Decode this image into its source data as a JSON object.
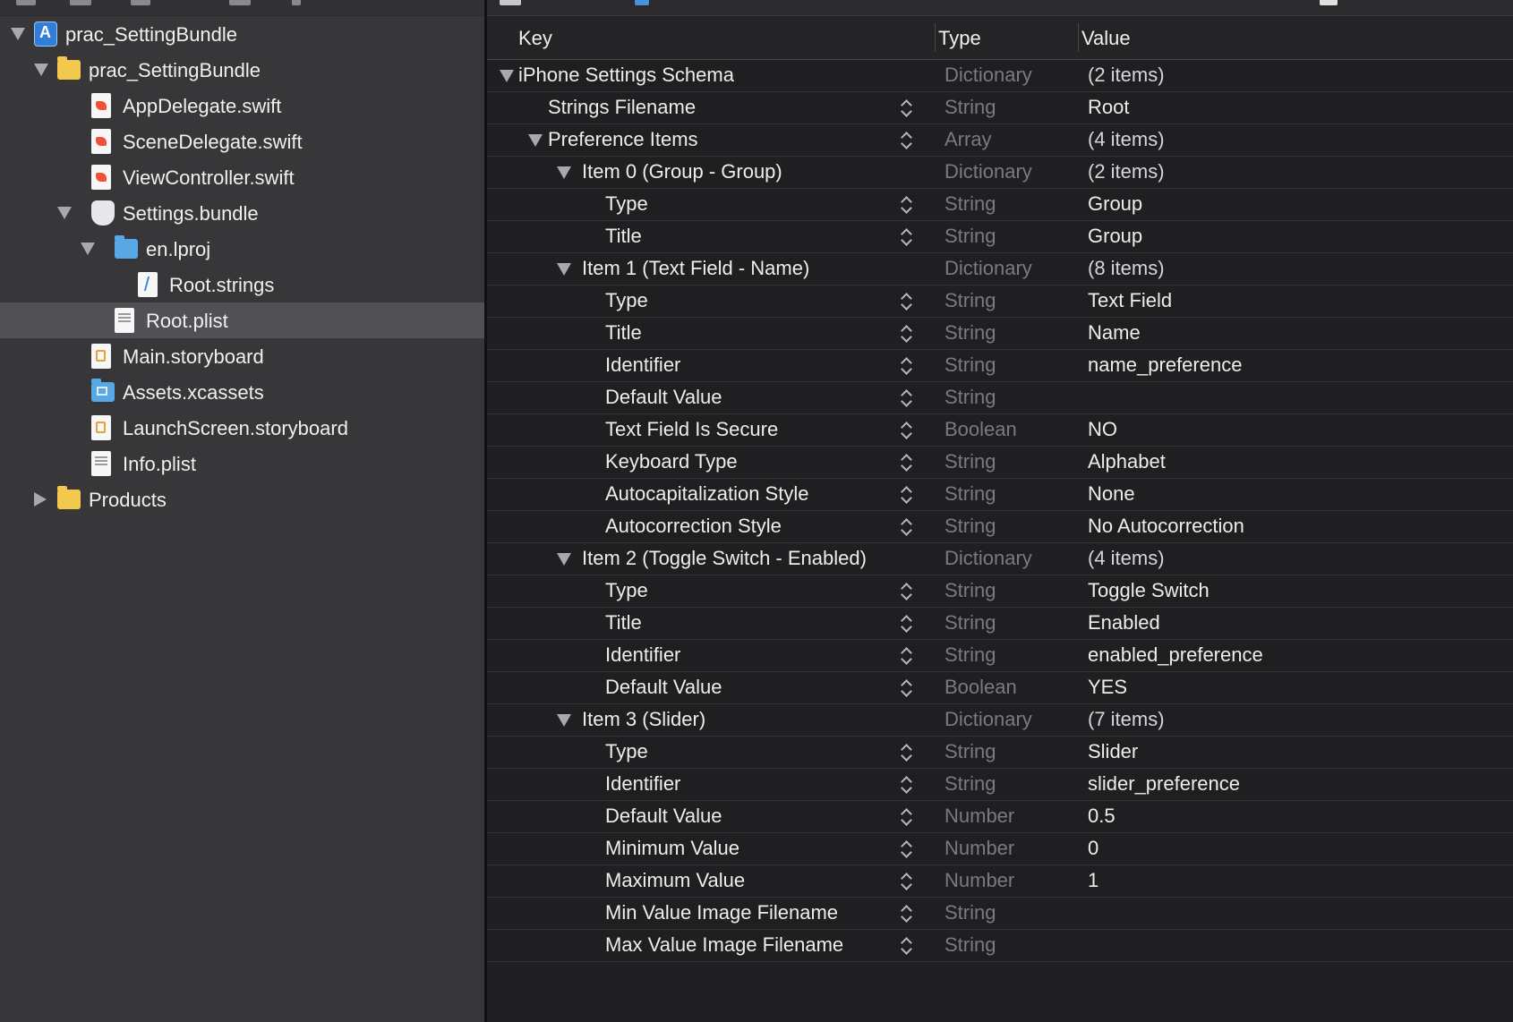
{
  "navigator": {
    "items": [
      {
        "label": "prac_SettingBundle",
        "icon": "xcode-project-icon",
        "level": 0,
        "disclosure": "open",
        "selected": false
      },
      {
        "label": "prac_SettingBundle",
        "icon": "yellow-folder-icon",
        "level": 1,
        "disclosure": "open",
        "selected": false
      },
      {
        "label": "AppDelegate.swift",
        "icon": "swift-file-icon",
        "level": 2,
        "disclosure": "none",
        "selected": false
      },
      {
        "label": "SceneDelegate.swift",
        "icon": "swift-file-icon",
        "level": 2,
        "disclosure": "none",
        "selected": false
      },
      {
        "label": "ViewController.swift",
        "icon": "swift-file-icon",
        "level": 2,
        "disclosure": "none",
        "selected": false
      },
      {
        "label": "Settings.bundle",
        "icon": "settings-bundle-icon",
        "level": 2,
        "disclosure": "open",
        "selected": false
      },
      {
        "label": "en.lproj",
        "icon": "blue-folder-icon",
        "level": 3,
        "disclosure": "open",
        "selected": false
      },
      {
        "label": "Root.strings",
        "icon": "strings-file-icon",
        "level": 4,
        "disclosure": "none",
        "selected": false
      },
      {
        "label": "Root.plist",
        "icon": "plist-file-icon",
        "level": 3,
        "disclosure": "none",
        "selected": true
      },
      {
        "label": "Main.storyboard",
        "icon": "storyboard-file-icon",
        "level": 2,
        "disclosure": "none",
        "selected": false
      },
      {
        "label": "Assets.xcassets",
        "icon": "asset-catalog-icon",
        "level": 2,
        "disclosure": "none",
        "selected": false
      },
      {
        "label": "LaunchScreen.storyboard",
        "icon": "storyboard-file-icon",
        "level": 2,
        "disclosure": "none",
        "selected": false
      },
      {
        "label": "Info.plist",
        "icon": "plist-file-icon",
        "level": 2,
        "disclosure": "none",
        "selected": false
      },
      {
        "label": "Products",
        "icon": "yellow-folder-icon",
        "level": 1,
        "disclosure": "closed",
        "selected": false
      }
    ]
  },
  "editor": {
    "columns": {
      "key": "Key",
      "type": "Type",
      "value": "Value"
    },
    "rows": [
      {
        "key": "iPhone Settings Schema",
        "type": "Dictionary",
        "value": "(2 items)",
        "level": 0,
        "disclosure": "open",
        "stepper": false
      },
      {
        "key": "Strings Filename",
        "type": "String",
        "value": "Root",
        "level": 1,
        "disclosure": "none",
        "stepper": true
      },
      {
        "key": "Preference Items",
        "type": "Array",
        "value": "(4 items)",
        "level": 1,
        "disclosure": "open",
        "stepper": true
      },
      {
        "key": "Item 0 (Group - Group)",
        "type": "Dictionary",
        "value": "(2 items)",
        "level": 2,
        "disclosure": "open",
        "stepper": false
      },
      {
        "key": "Type",
        "type": "String",
        "value": "Group",
        "level": 3,
        "disclosure": "none",
        "stepper": true
      },
      {
        "key": "Title",
        "type": "String",
        "value": "Group",
        "level": 3,
        "disclosure": "none",
        "stepper": true
      },
      {
        "key": "Item 1 (Text Field - Name)",
        "type": "Dictionary",
        "value": "(8 items)",
        "level": 2,
        "disclosure": "open",
        "stepper": false
      },
      {
        "key": "Type",
        "type": "String",
        "value": "Text Field",
        "level": 3,
        "disclosure": "none",
        "stepper": true
      },
      {
        "key": "Title",
        "type": "String",
        "value": "Name",
        "level": 3,
        "disclosure": "none",
        "stepper": true
      },
      {
        "key": "Identifier",
        "type": "String",
        "value": "name_preference",
        "level": 3,
        "disclosure": "none",
        "stepper": true
      },
      {
        "key": "Default Value",
        "type": "String",
        "value": "",
        "level": 3,
        "disclosure": "none",
        "stepper": true
      },
      {
        "key": "Text Field Is Secure",
        "type": "Boolean",
        "value": "NO",
        "level": 3,
        "disclosure": "none",
        "stepper": true
      },
      {
        "key": "Keyboard Type",
        "type": "String",
        "value": "Alphabet",
        "level": 3,
        "disclosure": "none",
        "stepper": true
      },
      {
        "key": "Autocapitalization Style",
        "type": "String",
        "value": "None",
        "level": 3,
        "disclosure": "none",
        "stepper": true
      },
      {
        "key": "Autocorrection Style",
        "type": "String",
        "value": "No Autocorrection",
        "level": 3,
        "disclosure": "none",
        "stepper": true
      },
      {
        "key": "Item 2 (Toggle Switch - Enabled)",
        "type": "Dictionary",
        "value": "(4 items)",
        "level": 2,
        "disclosure": "open",
        "stepper": false
      },
      {
        "key": "Type",
        "type": "String",
        "value": "Toggle Switch",
        "level": 3,
        "disclosure": "none",
        "stepper": true
      },
      {
        "key": "Title",
        "type": "String",
        "value": "Enabled",
        "level": 3,
        "disclosure": "none",
        "stepper": true
      },
      {
        "key": "Identifier",
        "type": "String",
        "value": "enabled_preference",
        "level": 3,
        "disclosure": "none",
        "stepper": true
      },
      {
        "key": "Default Value",
        "type": "Boolean",
        "value": "YES",
        "level": 3,
        "disclosure": "none",
        "stepper": true
      },
      {
        "key": "Item 3 (Slider)",
        "type": "Dictionary",
        "value": "(7 items)",
        "level": 2,
        "disclosure": "open",
        "stepper": false
      },
      {
        "key": "Type",
        "type": "String",
        "value": "Slider",
        "level": 3,
        "disclosure": "none",
        "stepper": true
      },
      {
        "key": "Identifier",
        "type": "String",
        "value": "slider_preference",
        "level": 3,
        "disclosure": "none",
        "stepper": true
      },
      {
        "key": "Default Value",
        "type": "Number",
        "value": "0.5",
        "level": 3,
        "disclosure": "none",
        "stepper": true
      },
      {
        "key": "Minimum Value",
        "type": "Number",
        "value": "0",
        "level": 3,
        "disclosure": "none",
        "stepper": true
      },
      {
        "key": "Maximum Value",
        "type": "Number",
        "value": "1",
        "level": 3,
        "disclosure": "none",
        "stepper": true
      },
      {
        "key": "Min Value Image Filename",
        "type": "String",
        "value": "",
        "level": 3,
        "disclosure": "none",
        "stepper": true
      },
      {
        "key": "Max Value Image Filename",
        "type": "String",
        "value": "",
        "level": 3,
        "disclosure": "none",
        "stepper": true
      }
    ]
  }
}
